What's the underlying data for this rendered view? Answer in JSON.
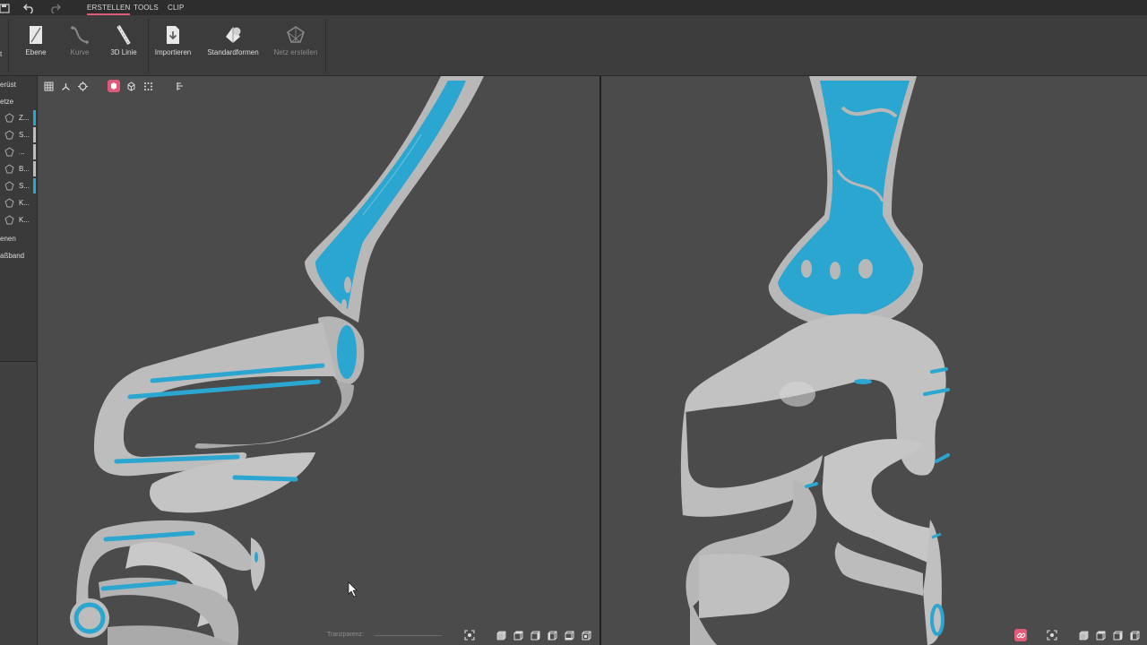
{
  "app": {
    "tabs": [
      "ERSTELLEN",
      "TOOLS",
      "CLIP"
    ],
    "active_tab": "ERSTELLEN"
  },
  "ribbon": {
    "buttons": [
      {
        "label": "Ebene",
        "icon": "plane-icon",
        "enabled": true
      },
      {
        "label": "Kurve",
        "icon": "curve-icon",
        "enabled": false
      },
      {
        "label": "3D Linie",
        "icon": "3d-line-icon",
        "enabled": true
      },
      {
        "label": "Importieren",
        "icon": "import-icon",
        "enabled": true
      },
      {
        "label": "Standardformen",
        "icon": "standard-shapes-icon",
        "enabled": true
      },
      {
        "label": "Netz erstellen",
        "icon": "create-mesh-icon",
        "enabled": false
      }
    ],
    "cut_off_label": "t"
  },
  "left_panel": {
    "section_gerust": "erüst",
    "section_netze": "etze",
    "items": [
      {
        "label": "Z...",
        "highlight": true
      },
      {
        "label": "S...",
        "highlight": false
      },
      {
        "label": "...",
        "highlight": false
      },
      {
        "label": "B...",
        "highlight": false
      },
      {
        "label": "S...",
        "highlight": true
      },
      {
        "label": "K...",
        "highlight": false
      },
      {
        "label": "K...",
        "highlight": false
      }
    ],
    "section_ebenen": "enen",
    "section_massband": "aßband"
  },
  "viewport_left": {
    "transparency_label": "Tranzparenz:"
  },
  "colors": {
    "accent_pink": "#e05a7a",
    "mesh_blue": "#2aa6d0",
    "model_grey": "#b8b8b8",
    "viewport_bg": "#4b4b4b"
  }
}
